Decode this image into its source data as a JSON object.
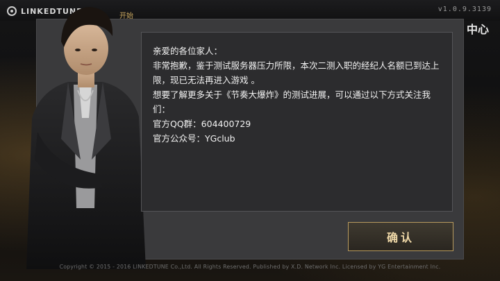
{
  "header": {
    "logo_text": "LINKEDTUNE",
    "version": "v1.0.9.3139",
    "partial_label": "开始",
    "center_label": "中心"
  },
  "dialog": {
    "lines": [
      "亲爱的各位家人：",
      "非常抱歉，鉴于测试服务器压力所限，本次二测入职的经纪人名额已到达上限，现已无法再进入游戏 。",
      "想要了解更多关于《节奏大爆炸》的测试进展，可以通过以下方式关注我们：",
      "官方QQ群：604400729",
      "官方公众号：YGclub"
    ]
  },
  "buttons": {
    "confirm_label": "确认"
  },
  "footer": {
    "copyright": "Copyright © 2015 - 2016 LINKEDTUNE Co.,Ltd. All Rights Reserved. Published by X.D. Network Inc. Licensed by YG Entertainment Inc."
  },
  "colors": {
    "accent_gold": "#b89a5e",
    "dialog_bg": "#2c2c2e",
    "panel_bg": "#3a3a3c"
  }
}
